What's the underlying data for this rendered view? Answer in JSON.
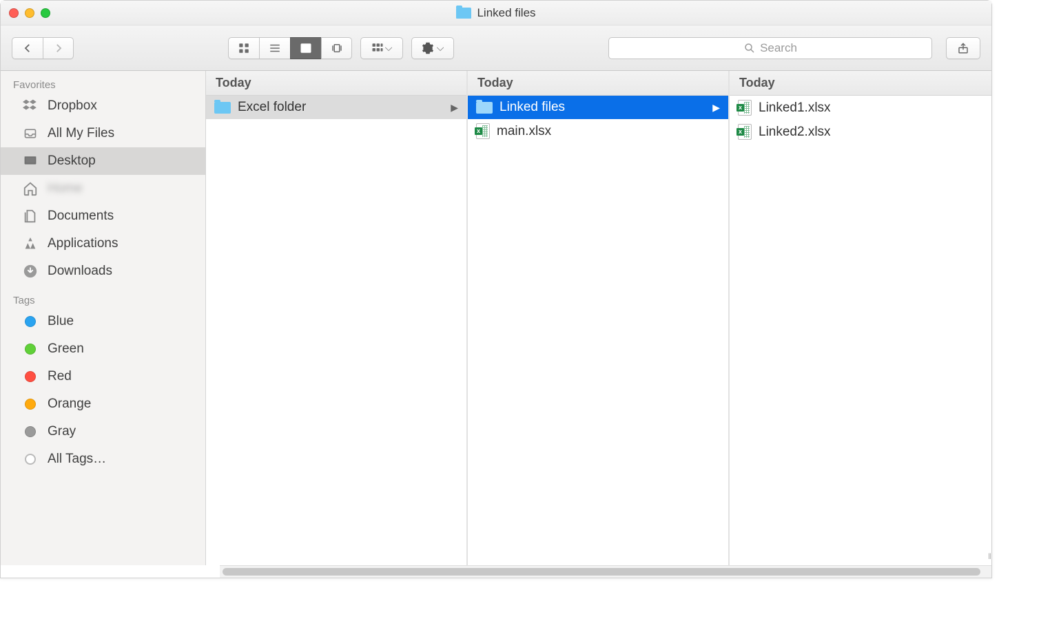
{
  "window": {
    "title": "Linked files"
  },
  "search": {
    "placeholder": "Search"
  },
  "sidebar": {
    "favorites_label": "Favorites",
    "tags_label": "Tags",
    "items": [
      {
        "label": "Dropbox"
      },
      {
        "label": "All My Files"
      },
      {
        "label": "Desktop"
      },
      {
        "label": "Home"
      },
      {
        "label": "Documents"
      },
      {
        "label": "Applications"
      },
      {
        "label": "Downloads"
      }
    ],
    "tags": [
      {
        "label": "Blue"
      },
      {
        "label": "Green"
      },
      {
        "label": "Red"
      },
      {
        "label": "Orange"
      },
      {
        "label": "Gray"
      },
      {
        "label": "All Tags…"
      }
    ]
  },
  "columns": [
    {
      "header": "Today",
      "items": [
        {
          "label": "Excel folder",
          "kind": "folder",
          "nav": true
        }
      ]
    },
    {
      "header": "Today",
      "items": [
        {
          "label": "Linked files",
          "kind": "folder",
          "selected": true
        },
        {
          "label": "main.xlsx",
          "kind": "xlsx"
        }
      ]
    },
    {
      "header": "Today",
      "items": [
        {
          "label": "Linked1.xlsx",
          "kind": "xlsx"
        },
        {
          "label": "Linked2.xlsx",
          "kind": "xlsx"
        }
      ]
    }
  ]
}
